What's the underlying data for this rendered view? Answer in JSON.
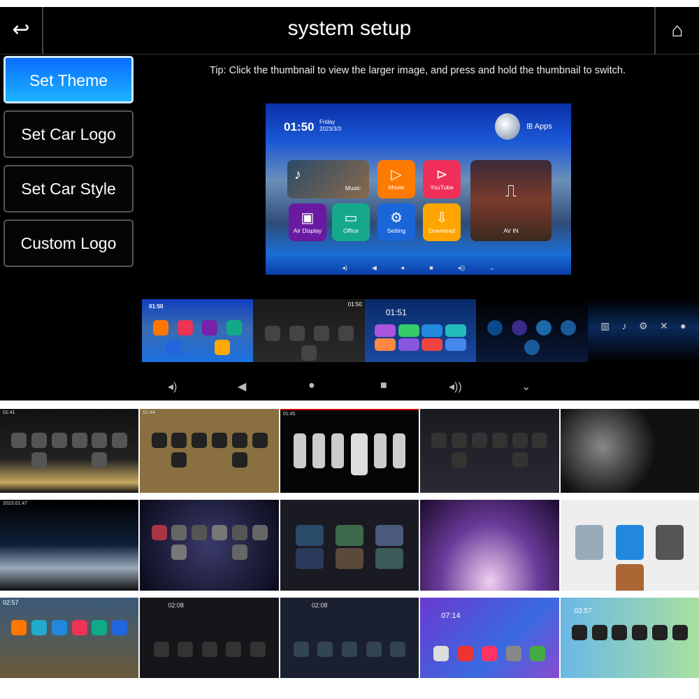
{
  "header": {
    "title": "system setup",
    "back_icon": "back-arrow-icon",
    "home_icon": "home-icon"
  },
  "sidebar": {
    "items": [
      {
        "label": "Set Theme",
        "active": true
      },
      {
        "label": "Set Car Logo"
      },
      {
        "label": "Set Car Style"
      },
      {
        "label": "Custom Logo"
      }
    ]
  },
  "tip": "Tip: Click the thumbnail to view the larger image, and press and hold the thumbnail to switch.",
  "preview": {
    "time": "01:50",
    "day": "Friday",
    "date": "2023/3/3",
    "apps_label": "Apps",
    "tiles": [
      {
        "label": "Music",
        "color": "#5a4a3a"
      },
      {
        "label": "Movie",
        "color": "#ff7a00"
      },
      {
        "label": "YouTube",
        "color": "#f0305a"
      },
      {
        "label": "AV IN",
        "color": "#5a3a2a"
      },
      {
        "label": "Air Display",
        "color": "#6a1aa0"
      },
      {
        "label": "Office",
        "color": "#16a88a"
      },
      {
        "label": "Setting",
        "color": "#1a66d8"
      },
      {
        "label": "Download",
        "color": "#ffa500"
      }
    ]
  },
  "theme_strip": {
    "times": [
      "01:50",
      "01:50",
      "01:51"
    ]
  },
  "nav_icons": [
    "volume-down-icon",
    "back-triangle-icon",
    "home-circle-icon",
    "recents-square-icon",
    "volume-up-icon",
    "chevron-down-icon"
  ],
  "gallery": {
    "row1_times": [
      "01:41",
      "01:44",
      "01:45"
    ],
    "row2_times": [
      "2023.01.47"
    ],
    "row3_times": [
      "02:57",
      "02:08",
      "02:08",
      "07:14",
      "03:57"
    ]
  },
  "accent": "#0a8cff"
}
